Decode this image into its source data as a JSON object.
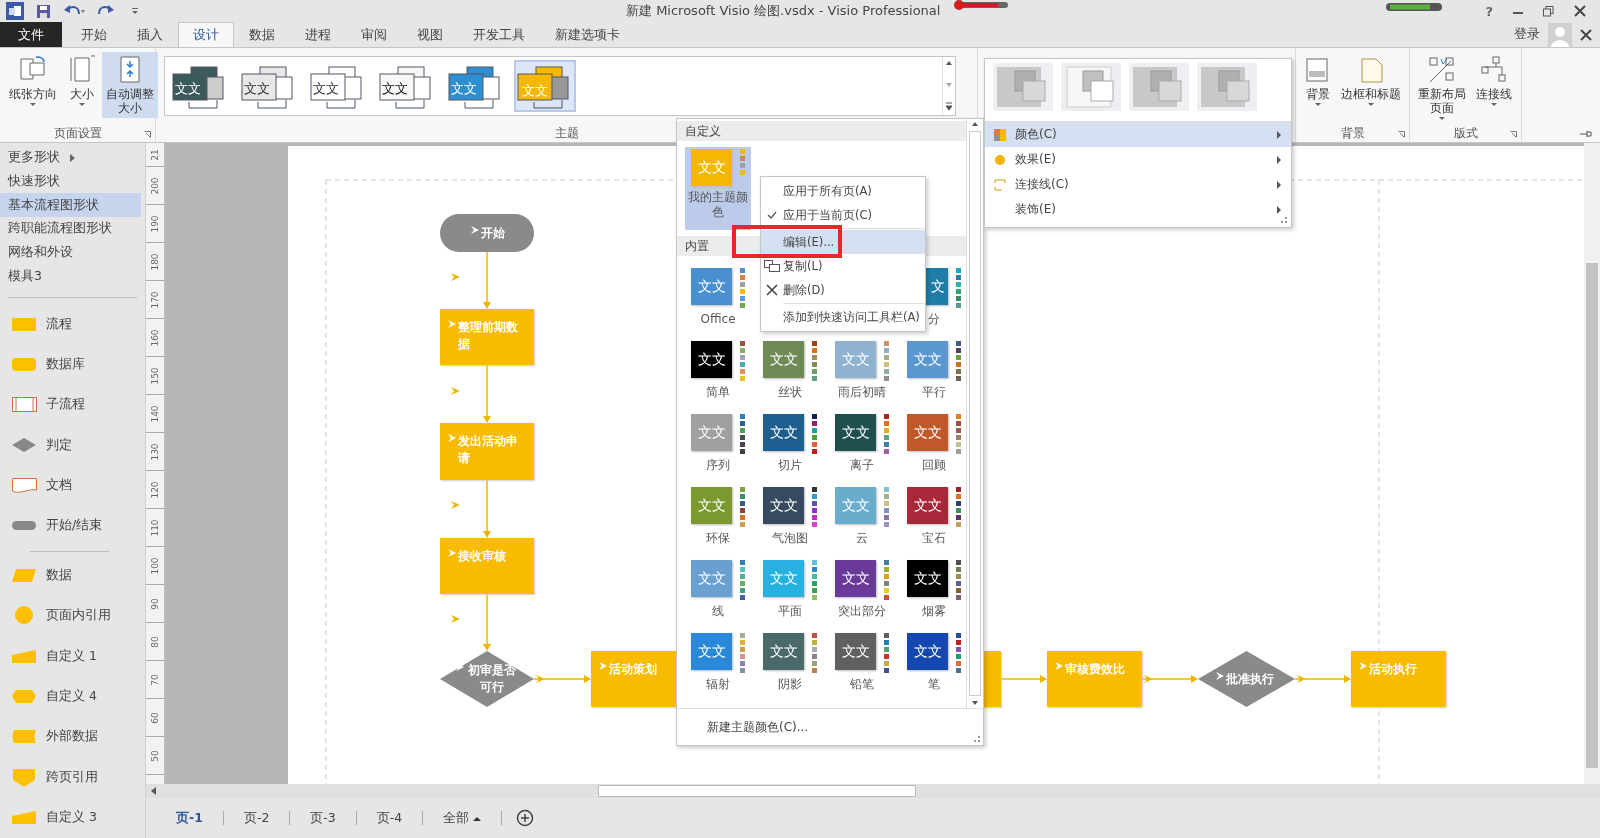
{
  "title_bar": {
    "title": "新建 Microsoft Visio 绘图.vsdx - Visio Professional",
    "help": "?"
  },
  "ribbon_tabs": [
    {
      "label": "文件",
      "kind": "file",
      "selected": false
    },
    {
      "label": "开始",
      "kind": "tab",
      "selected": false
    },
    {
      "label": "插入",
      "kind": "tab",
      "selected": false
    },
    {
      "label": "设计",
      "kind": "tab",
      "selected": true
    },
    {
      "label": "数据",
      "kind": "tab",
      "selected": false
    },
    {
      "label": "进程",
      "kind": "tab",
      "selected": false
    },
    {
      "label": "审阅",
      "kind": "tab",
      "selected": false
    },
    {
      "label": "视图",
      "kind": "tab",
      "selected": false
    },
    {
      "label": "开发工具",
      "kind": "tab",
      "selected": false
    },
    {
      "label": "新建选项卡",
      "kind": "tab",
      "selected": false
    }
  ],
  "account": {
    "sign_in": "登录"
  },
  "ribbon": {
    "page_setup": {
      "label": "页面设置",
      "buttons": [
        {
          "label": "纸张方向",
          "menu": true,
          "selected": false
        },
        {
          "label": "大小",
          "menu": true,
          "selected": false
        },
        {
          "label": "自动调整大小",
          "menu": false,
          "selected": true
        }
      ]
    },
    "themes": {
      "label": "主题",
      "items": [
        {
          "text": "文文",
          "kind": "dark",
          "selected": false
        },
        {
          "text": "文文",
          "kind": "light",
          "selected": false
        },
        {
          "text": "文文",
          "kind": "outline",
          "selected": false
        },
        {
          "text": "文文",
          "kind": "sketch",
          "selected": false
        },
        {
          "text": "文文",
          "kind": "blue",
          "selected": false
        },
        {
          "text": "文文",
          "kind": "yellow",
          "selected": true
        }
      ]
    },
    "background": {
      "label": "背景",
      "buttons": [
        {
          "label": "背景",
          "menu": true
        },
        {
          "label": "边框和标题",
          "menu": true
        }
      ]
    },
    "layout": {
      "label": "版式",
      "buttons": [
        {
          "label": "重新布局页面",
          "menu": true
        },
        {
          "label": "连接线",
          "menu": true
        }
      ]
    }
  },
  "shapes_panel": {
    "nav": [
      {
        "label": "更多形状",
        "submenu": true,
        "selected": false
      },
      {
        "label": "快速形状",
        "submenu": false,
        "selected": false
      },
      {
        "label": "基本流程图形状",
        "submenu": false,
        "selected": true
      },
      {
        "label": "跨职能流程图形状",
        "submenu": false,
        "selected": false
      },
      {
        "label": "网络和外设",
        "submenu": false,
        "selected": false
      },
      {
        "label": "模具3",
        "submenu": false,
        "selected": false
      }
    ],
    "stencils": [
      {
        "label": "流程",
        "kind": "process",
        "separator_before": false
      },
      {
        "label": "数据库",
        "kind": "database",
        "separator_before": false
      },
      {
        "label": "子流程",
        "kind": "subprocess",
        "separator_before": false
      },
      {
        "label": "判定",
        "kind": "decision",
        "separator_before": false
      },
      {
        "label": "文档",
        "kind": "document",
        "separator_before": false
      },
      {
        "label": "开始/结束",
        "kind": "terminator",
        "separator_before": false
      },
      {
        "label": "数据",
        "kind": "data",
        "separator_before": true
      },
      {
        "label": "页面内引用",
        "kind": "circle",
        "separator_before": false
      },
      {
        "label": "自定义 1",
        "kind": "manual",
        "separator_before": false
      },
      {
        "label": "自定义 4",
        "kind": "hexagon",
        "separator_before": false
      },
      {
        "label": "外部数据",
        "kind": "stored",
        "separator_before": false
      },
      {
        "label": "跨页引用",
        "kind": "offpage",
        "separator_before": false
      },
      {
        "label": "自定义 3",
        "kind": "manual",
        "separator_before": false
      }
    ]
  },
  "ruler": {
    "labels": [
      "21",
      "200",
      "190",
      "180",
      "170",
      "160",
      "150",
      "140",
      "130",
      "120",
      "110",
      "100",
      "90",
      "80",
      "70",
      "60",
      "50"
    ]
  },
  "diagram": {
    "nodes": [
      {
        "text": "开始",
        "kind": "terminator"
      },
      {
        "text": "整理前期数据",
        "kind": "process"
      },
      {
        "text": "发出活动申请",
        "kind": "process"
      },
      {
        "text": "接收审核",
        "kind": "process"
      },
      {
        "text": "初审是否可行",
        "kind": "decision"
      },
      {
        "text": "活动策划",
        "kind": "process"
      },
      {
        "kind": "process"
      },
      {
        "text": "审核费效比",
        "kind": "process"
      },
      {
        "text": "批准执行",
        "kind": "decision"
      },
      {
        "text": "活动执行",
        "kind": "process"
      }
    ]
  },
  "page_tabs": [
    {
      "label": "页-1",
      "selected": true,
      "menu": false
    },
    {
      "label": "页-2",
      "selected": false,
      "menu": false
    },
    {
      "label": "页-3",
      "selected": false,
      "menu": false
    },
    {
      "label": "页-4",
      "selected": false,
      "menu": false
    },
    {
      "label": "全部",
      "selected": false,
      "menu": true
    }
  ],
  "color_gallery": {
    "custom_header": "自定义",
    "custom": [
      {
        "label": "我的主题颜色",
        "text": "文文",
        "color": "#f5b800",
        "selected": true,
        "dots": [
          {
            "color": "#f5b800"
          },
          {
            "color": "#c98a4a"
          },
          {
            "color": "#a0a0a0"
          },
          {
            "color": "#f5b800"
          }
        ]
      }
    ],
    "builtin_header": "内置",
    "builtin_rows": [
      [
        {
          "label": "Office",
          "text": "文文",
          "color": "#4a8fd0",
          "selected": false,
          "dots": [
            {
              "color": "#4a8fd0"
            },
            {
              "color": "#e07b3a"
            },
            {
              "color": "#a0a0a0"
            },
            {
              "color": "#f5b800"
            },
            {
              "color": "#5a9bd5"
            },
            {
              "color": "#70ad47"
            }
          ]
        },
        {
          "label": "分",
          "text": "文",
          "color": "#1f7ea8",
          "selected": false,
          "dots": [
            {
              "color": "#21a4c8"
            },
            {
              "color": "#2a7ea8"
            },
            {
              "color": "#20b8a8"
            },
            {
              "color": "#2ca870"
            },
            {
              "color": "#3a8a60"
            },
            {
              "color": "#5a9a90"
            }
          ]
        }
      ],
      [
        {
          "label": "简单",
          "text": "文文",
          "color": "#000000",
          "selected": false,
          "dots": [
            {
              "color": "#a05040"
            },
            {
              "color": "#80b060"
            },
            {
              "color": "#a0a0c0"
            },
            {
              "color": "#40b0b0"
            },
            {
              "color": "#e09060"
            },
            {
              "color": "#e8c020"
            }
          ]
        },
        {
          "label": "丝状",
          "text": "文文",
          "color": "#6f8a55",
          "selected": false,
          "dots": [
            {
              "color": "#a04010"
            },
            {
              "color": "#e07020"
            },
            {
              "color": "#a09060"
            },
            {
              "color": "#809050"
            },
            {
              "color": "#70a060"
            },
            {
              "color": "#60a090"
            }
          ]
        },
        {
          "label": "雨后初晴",
          "text": "文文",
          "color": "#8fb2d0",
          "selected": false,
          "dots": [
            {
              "color": "#d09060"
            },
            {
              "color": "#90b0c0"
            },
            {
              "color": "#a0b080"
            },
            {
              "color": "#d0c080"
            },
            {
              "color": "#90b0a0"
            },
            {
              "color": "#909090"
            }
          ]
        },
        {
          "label": "平行",
          "text": "文文",
          "color": "#5a97d0",
          "selected": false,
          "dots": [
            {
              "color": "#406080"
            },
            {
              "color": "#504060"
            },
            {
              "color": "#70a040"
            },
            {
              "color": "#d07020"
            },
            {
              "color": "#807050"
            },
            {
              "color": "#706050"
            }
          ]
        }
      ],
      [
        {
          "label": "序列",
          "text": "文文",
          "color": "#a0a0a0",
          "selected": false,
          "dots": [
            {
              "color": "#2a80b0"
            },
            {
              "color": "#306090"
            },
            {
              "color": "#50a050"
            },
            {
              "color": "#405040"
            },
            {
              "color": "#504050"
            },
            {
              "color": "#404040"
            }
          ]
        },
        {
          "label": "切片",
          "text": "文文",
          "color": "#1f5f8f",
          "selected": false,
          "dots": [
            {
              "color": "#102050"
            },
            {
              "color": "#902070"
            },
            {
              "color": "#20a0a0"
            },
            {
              "color": "#50a030"
            },
            {
              "color": "#e06040"
            },
            {
              "color": "#c02020"
            }
          ]
        },
        {
          "label": "离子",
          "text": "文文",
          "color": "#1f4f4f",
          "selected": false,
          "dots": [
            {
              "color": "#b02020"
            },
            {
              "color": "#e07020"
            },
            {
              "color": "#e0b020"
            },
            {
              "color": "#60a080"
            },
            {
              "color": "#4080a0"
            },
            {
              "color": "#a060a0"
            }
          ]
        },
        {
          "label": "回顾",
          "text": "文文",
          "color": "#c0582a",
          "selected": false,
          "dots": [
            {
              "color": "#e08020"
            },
            {
              "color": "#a05040"
            },
            {
              "color": "#906050"
            },
            {
              "color": "#a08060"
            },
            {
              "color": "#c0c090"
            },
            {
              "color": "#a0a090"
            }
          ]
        }
      ],
      [
        {
          "label": "环保",
          "text": "文文",
          "color": "#7a9a30",
          "selected": false,
          "dots": [
            {
              "color": "#80a040"
            },
            {
              "color": "#409070"
            },
            {
              "color": "#306080"
            },
            {
              "color": "#904030"
            },
            {
              "color": "#e07020"
            },
            {
              "color": "#d0a040"
            }
          ]
        },
        {
          "label": "气泡图",
          "text": "文文",
          "color": "#374a60",
          "selected": false,
          "dots": [
            {
              "color": "#303030"
            },
            {
              "color": "#30a0c0"
            },
            {
              "color": "#6050a0"
            },
            {
              "color": "#9030c0"
            },
            {
              "color": "#c030c0"
            },
            {
              "color": "#e040c0"
            }
          ]
        },
        {
          "label": "云",
          "text": "文文",
          "color": "#6aaccc",
          "selected": false,
          "dots": [
            {
              "color": "#80c0d0"
            },
            {
              "color": "#a0b090"
            },
            {
              "color": "#d0c080"
            },
            {
              "color": "#8090c0"
            },
            {
              "color": "#9070b0"
            },
            {
              "color": "#a090c0"
            }
          ]
        },
        {
          "label": "宝石",
          "text": "文文",
          "color": "#a8283a",
          "selected": false,
          "dots": [
            {
              "color": "#a02030"
            },
            {
              "color": "#e07020"
            },
            {
              "color": "#304060"
            },
            {
              "color": "#409060"
            },
            {
              "color": "#603060"
            },
            {
              "color": "#c0a060"
            }
          ]
        }
      ],
      [
        {
          "label": "线",
          "text": "文文",
          "color": "#6aa0d0",
          "selected": false,
          "dots": [
            {
              "color": "#3080b0"
            },
            {
              "color": "#50c0c0"
            },
            {
              "color": "#50b090"
            },
            {
              "color": "#70b060"
            },
            {
              "color": "#40a080"
            },
            {
              "color": "#4060a0"
            }
          ]
        },
        {
          "label": "平面",
          "text": "文文",
          "color": "#28b0e0",
          "selected": false,
          "dots": [
            {
              "color": "#60c0e0"
            },
            {
              "color": "#2090c0"
            },
            {
              "color": "#40c0a0"
            },
            {
              "color": "#30a060"
            },
            {
              "color": "#40a050"
            },
            {
              "color": "#90c060"
            }
          ]
        },
        {
          "label": "突出部分",
          "text": "文文",
          "color": "#6a3a9a",
          "selected": false,
          "dots": [
            {
              "color": "#4080a0"
            },
            {
              "color": "#a0b020"
            },
            {
              "color": "#e0a020"
            },
            {
              "color": "#808080"
            },
            {
              "color": "#e0d020"
            },
            {
              "color": "#d05030"
            }
          ]
        },
        {
          "label": "烟雾",
          "text": "文文",
          "color": "#000000",
          "selected": false,
          "dots": [
            {
              "color": "#505050"
            },
            {
              "color": "#708050"
            },
            {
              "color": "#a09050"
            },
            {
              "color": "#606090"
            },
            {
              "color": "#806030"
            },
            {
              "color": "#806070"
            }
          ]
        }
      ],
      [
        {
          "label": "辐射",
          "text": "文文",
          "color": "#2a88d8",
          "selected": false,
          "dots": [
            {
              "color": "#a0b090"
            },
            {
              "color": "#e0b030"
            },
            {
              "color": "#d0a040"
            },
            {
              "color": "#d090a0"
            },
            {
              "color": "#9080b0"
            },
            {
              "color": "#8090b0"
            }
          ]
        },
        {
          "label": "阴影",
          "text": "文文",
          "color": "#4a6a6a",
          "selected": false,
          "dots": [
            {
              "color": "#c05040"
            },
            {
              "color": "#c0b030"
            },
            {
              "color": "#a0b0b0"
            },
            {
              "color": "#908090"
            },
            {
              "color": "#a0a080"
            },
            {
              "color": "#c08050"
            }
          ]
        },
        {
          "label": "铅笔",
          "text": "文文",
          "color": "#606060",
          "selected": false,
          "dots": [
            {
              "color": "#606060"
            },
            {
              "color": "#2080b0"
            },
            {
              "color": "#50a070"
            },
            {
              "color": "#d03030"
            },
            {
              "color": "#c0b040"
            },
            {
              "color": "#405090"
            }
          ]
        },
        {
          "label": "笔",
          "text": "文文",
          "color": "#1448b0",
          "selected": false,
          "dots": [
            {
              "color": "#2050a0"
            },
            {
              "color": "#c02020"
            },
            {
              "color": "#8050c0"
            },
            {
              "color": "#20a070"
            },
            {
              "color": "#e07030"
            },
            {
              "color": "#507090"
            }
          ]
        }
      ]
    ],
    "footer": "新建主题颜色(C)..."
  },
  "context_menu": [
    {
      "label": "应用于所有页(A)",
      "kind": "plain",
      "checked": false,
      "selected": false,
      "separator_before": false
    },
    {
      "label": "应用于当前页(C)",
      "kind": "plain",
      "checked": true,
      "selected": false,
      "separator_before": false
    },
    {
      "label": "编辑(E)...",
      "kind": "plain",
      "checked": false,
      "selected": true,
      "separator_before": true
    },
    {
      "label": "复制(L)",
      "kind": "copy",
      "checked": false,
      "selected": false,
      "separator_before": false
    },
    {
      "label": "删除(D)",
      "kind": "delete",
      "checked": false,
      "selected": false,
      "separator_before": false
    },
    {
      "label": "添加到快速访问工具栏(A)",
      "kind": "plain",
      "checked": false,
      "selected": false,
      "separator_before": true
    }
  ],
  "variant_menu": {
    "variants": [
      {
        "kind": "solid"
      },
      {
        "kind": "outline"
      },
      {
        "kind": "solid"
      },
      {
        "kind": "solid"
      }
    ],
    "items": [
      {
        "label": "颜色(C)",
        "kind": "colors",
        "selected": true
      },
      {
        "label": "效果(E)",
        "kind": "effects",
        "selected": false
      },
      {
        "label": "连接线(C)",
        "kind": "connectors",
        "selected": false
      },
      {
        "label": "装饰(E)",
        "kind": "decor",
        "selected": false
      }
    ]
  }
}
